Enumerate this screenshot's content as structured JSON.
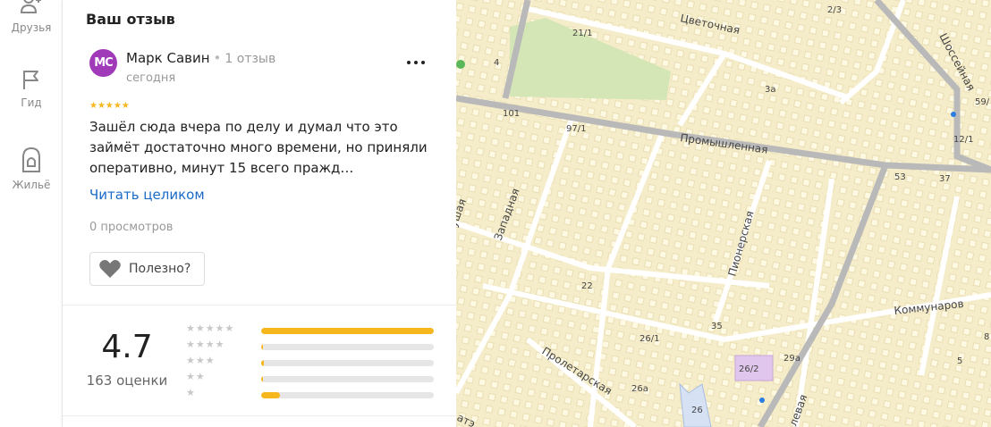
{
  "rail": {
    "items": [
      {
        "label": "Друзья"
      },
      {
        "label": "Гид"
      },
      {
        "label": "Жильё"
      }
    ]
  },
  "review": {
    "section_title": "Ваш отзыв",
    "avatar_initials": "МС",
    "avatar_color": "#a13ab9",
    "author_name": "Марк Савин",
    "author_reviews": "1 отзыв",
    "date": "сегодня",
    "rating_stars": 5,
    "text": "Зашёл сюда вчера по делу и думал что это займёт достаточно много времени, но приняли оперативно, минут 15 всего пражд…",
    "read_more": "Читать целиком",
    "views": "0 просмотров",
    "useful_label": "Полезно?"
  },
  "summary": {
    "rating": "4.7",
    "count_label": "163 оценки",
    "accent": "#f6b71c",
    "distribution": [
      {
        "stars": 5,
        "fraction": 1.0
      },
      {
        "stars": 4,
        "fraction": 0.01
      },
      {
        "stars": 3,
        "fraction": 0.015
      },
      {
        "stars": 2,
        "fraction": 0.01
      },
      {
        "stars": 1,
        "fraction": 0.11
      }
    ]
  },
  "map": {
    "labels": {
      "tsvetochnaya": "Цветочная",
      "shosseynaya": "Шоссейная",
      "promyshlennaya": "Промышленная",
      "zapadnaya": "Западная",
      "pionerskaya": "Пионерская",
      "kommunarov": "Коммунаров",
      "proletarskaya": "Пролетарская",
      "n21_1": "21/1",
      "n2_3": "2/3",
      "n4": "4",
      "n3a": "3а",
      "n59": "59/",
      "n101": "101",
      "n97_1": "97/1",
      "n12_1": "12/1",
      "n53": "53",
      "n37": "37",
      "n22": "22",
      "n35": "35",
      "n26_1": "26/1",
      "n26_2": "26/2",
      "n29a": "29а",
      "n26a": "26а",
      "n26": "26",
      "n5": "5",
      "n8": "8",
      "left1": "ушая",
      "left2": "атэ",
      "bottom_r": "левая"
    }
  }
}
